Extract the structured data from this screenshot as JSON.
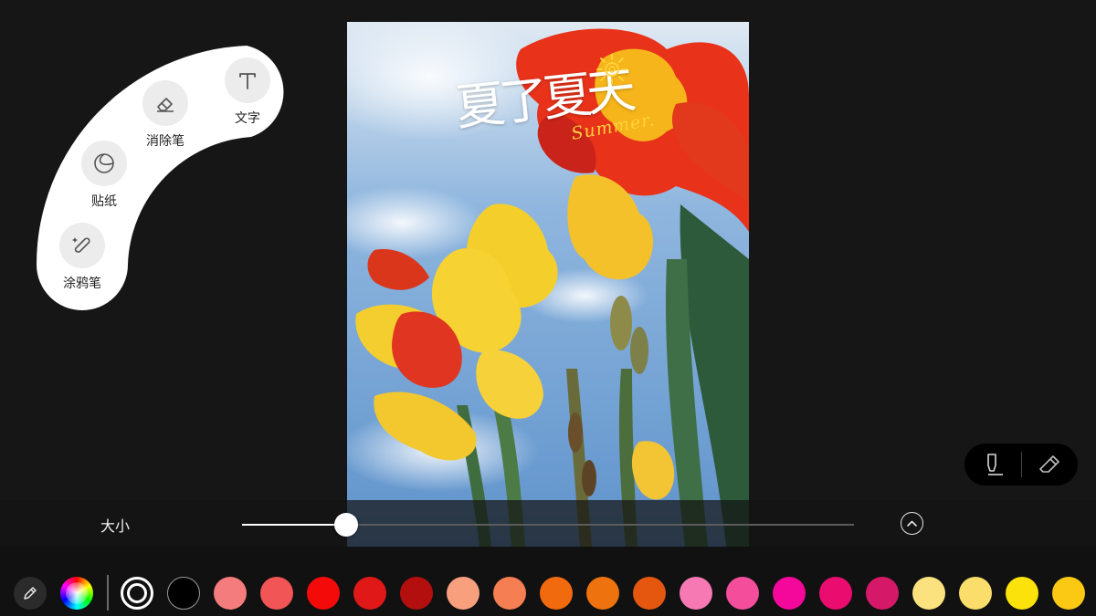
{
  "photo": {
    "title": "夏了夏天",
    "subtitle": "Summer."
  },
  "tools": [
    {
      "id": "doodle",
      "label": "涂鸦笔",
      "icon": "brush-sparkle-icon"
    },
    {
      "id": "sticker",
      "label": "贴纸",
      "icon": "sticker-icon"
    },
    {
      "id": "eraser",
      "label": "消除笔",
      "icon": "eraser-icon"
    },
    {
      "id": "text",
      "label": "文字",
      "icon": "text-t-icon"
    }
  ],
  "mode_toggle": {
    "left_icon": "marker-pen-icon",
    "right_icon": "eraser-icon"
  },
  "size_bar": {
    "label": "大小",
    "value_fraction": 0.17,
    "collapse_icon": "chevron-up-circle-icon"
  },
  "palette": {
    "pen_icon": "pen-icon",
    "color_wheel_icon": "color-wheel-icon",
    "selected_index": 0,
    "colors": [
      "#ffffff",
      "#000000",
      "#f47c7c",
      "#f15555",
      "#f50a0a",
      "#e01818",
      "#b30f0f",
      "#f8a07e",
      "#f57e52",
      "#f26a0e",
      "#ee720d",
      "#e5570f",
      "#f679b4",
      "#f44d9b",
      "#f4079b",
      "#ea0c6e",
      "#d61868",
      "#fbe27f",
      "#fadd6a",
      "#fae20a",
      "#fbc914"
    ]
  }
}
